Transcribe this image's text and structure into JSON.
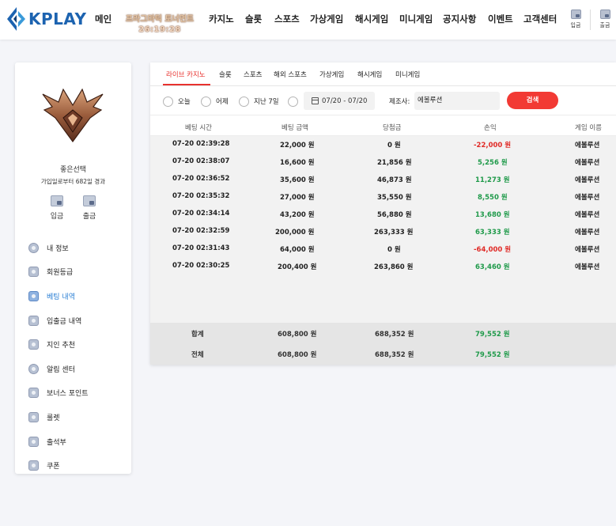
{
  "header": {
    "logo_text": "KPLAY",
    "nav": [
      "메인",
      "카지노",
      "슬롯",
      "스포츠",
      "가상게임",
      "해시게임",
      "미니게임",
      "공지사항",
      "이벤트",
      "고객센터"
    ],
    "promo_title": "프라그마틱 토너먼트",
    "promo_timer": "26:19:28",
    "deposit_label": "입금",
    "withdraw_label": "출금"
  },
  "sidebar": {
    "username": "좋은선택",
    "joined": "가입일로부터 682일 경과",
    "deposit_label": "입금",
    "withdraw_label": "출금",
    "menu": [
      {
        "label": "내 정보",
        "icon": "user-icon"
      },
      {
        "label": "회원등급",
        "icon": "grade-icon"
      },
      {
        "label": "베팅 내역",
        "icon": "betting-history-icon"
      },
      {
        "label": "입출금 내역",
        "icon": "transaction-icon"
      },
      {
        "label": "지인 추천",
        "icon": "referral-icon"
      },
      {
        "label": "알림 센터",
        "icon": "notification-icon"
      },
      {
        "label": "보너스 포인트",
        "icon": "bonus-icon"
      },
      {
        "label": "룰렛",
        "icon": "roulette-icon"
      },
      {
        "label": "출석부",
        "icon": "attendance-icon"
      },
      {
        "label": "쿠폰",
        "icon": "coupon-icon"
      }
    ]
  },
  "tabs": [
    "라이브 카지노",
    "슬롯",
    "스포츠",
    "해외 스포츠",
    "가상게임",
    "해시게임",
    "미니게임"
  ],
  "filters": {
    "radios": [
      "오늘",
      "어제",
      "지난 7일"
    ],
    "date_range": "07/20 - 07/20",
    "maker_label": "제조사:",
    "maker_value": "에볼루션",
    "search_label": "검색"
  },
  "table": {
    "headers": [
      "베팅 시간",
      "베팅 금액",
      "당첨금",
      "손익",
      "게임 이름"
    ],
    "rows": [
      {
        "time": "07-20 02:39:28",
        "bet": "22,000 원",
        "win": "0 원",
        "pl": "-22,000 원",
        "pl_sign": "neg",
        "game": "에볼루션"
      },
      {
        "time": "07-20 02:38:07",
        "bet": "16,600 원",
        "win": "21,856 원",
        "pl": "5,256 원",
        "pl_sign": "pos",
        "game": "에볼루션"
      },
      {
        "time": "07-20 02:36:52",
        "bet": "35,600 원",
        "win": "46,873 원",
        "pl": "11,273 원",
        "pl_sign": "pos",
        "game": "에볼루션"
      },
      {
        "time": "07-20 02:35:32",
        "bet": "27,000 원",
        "win": "35,550 원",
        "pl": "8,550 원",
        "pl_sign": "pos",
        "game": "에볼루션"
      },
      {
        "time": "07-20 02:34:14",
        "bet": "43,200 원",
        "win": "56,880 원",
        "pl": "13,680 원",
        "pl_sign": "pos",
        "game": "에볼루션"
      },
      {
        "time": "07-20 02:32:59",
        "bet": "200,000 원",
        "win": "263,333 원",
        "pl": "63,333 원",
        "pl_sign": "pos",
        "game": "에볼루션"
      },
      {
        "time": "07-20 02:31:43",
        "bet": "64,000 원",
        "win": "0 원",
        "pl": "-64,000 원",
        "pl_sign": "neg",
        "game": "에볼루션"
      },
      {
        "time": "07-20 02:30:25",
        "bet": "200,400 원",
        "win": "263,860 원",
        "pl": "63,460 원",
        "pl_sign": "pos",
        "game": "에볼루션"
      }
    ],
    "totals": [
      {
        "label": "합계",
        "bet": "608,800 원",
        "win": "688,352 원",
        "pl": "79,552 원"
      },
      {
        "label": "전체",
        "bet": "608,800 원",
        "win": "688,352 원",
        "pl": "79,552 원"
      }
    ]
  },
  "colors": {
    "accent_red": "#e8322e",
    "active_blue": "#2a7fd4",
    "positive": "#1f9a4a",
    "negative": "#e02a26",
    "logo_blue": "#1c63b0"
  }
}
